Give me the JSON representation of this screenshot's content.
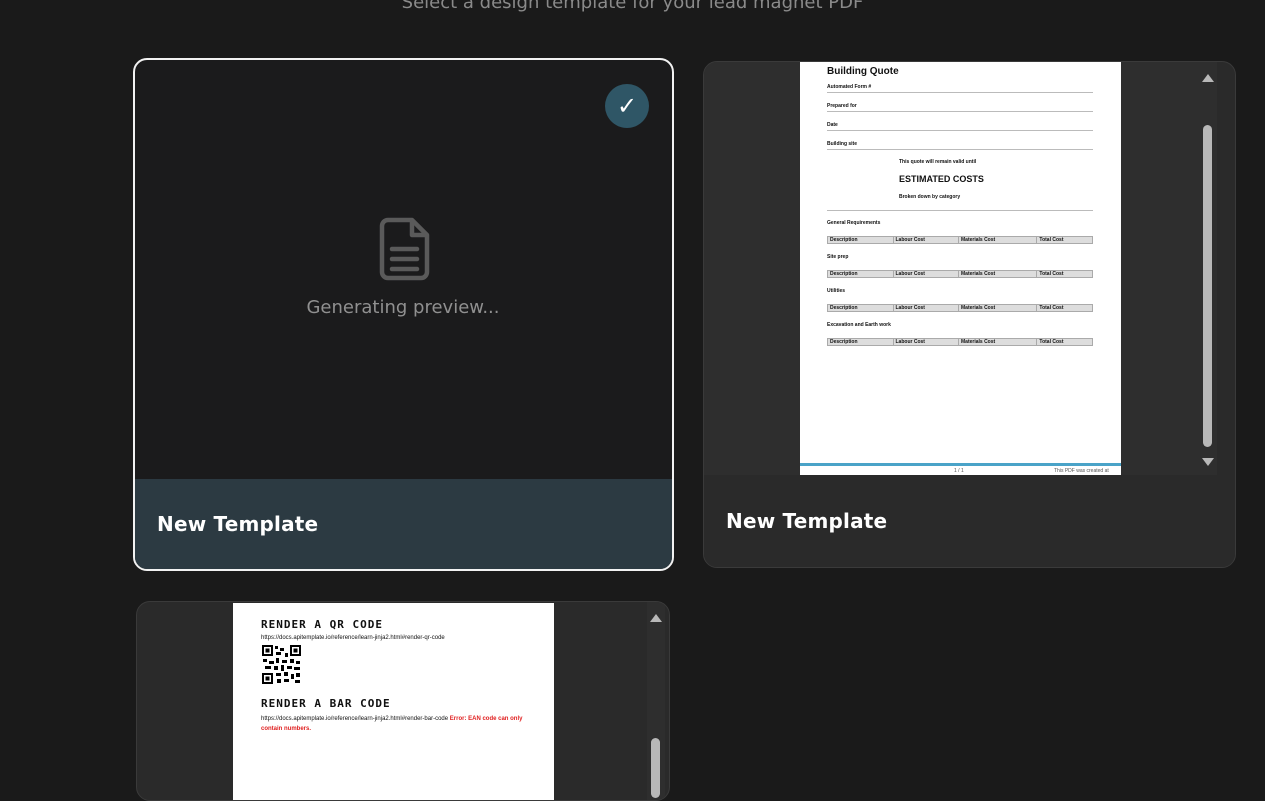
{
  "header": {
    "subtitle": "Select a design template for your lead magnet PDF"
  },
  "templates": [
    {
      "title": "New Template",
      "selected": true,
      "status": "Generating preview...",
      "icon": "document-icon",
      "check_icon": "checkmark-icon",
      "check_glyph": "✓"
    },
    {
      "title": "New Template",
      "selected": false,
      "preview": {
        "doc_title": "Building Quote",
        "fields": [
          "Automated Form #",
          "Prepared for",
          "Date",
          "Building site"
        ],
        "valid_note": "This quote will remain valid until",
        "heading": "ESTIMATED COSTS",
        "subheading": "Broken down by category",
        "sections": [
          "General Requirements",
          "Site prep",
          "Utilities",
          "Excavation and Earth work"
        ],
        "columns": [
          "Description",
          "Labour Cost",
          "Materials Cost",
          "Total Cost"
        ],
        "page_number": "1 / 1",
        "footer_note": "This PDF was created at"
      }
    },
    {
      "title": "",
      "selected": false,
      "preview": {
        "qr_heading": "RENDER A QR CODE",
        "qr_url": "https://docs.apitemplate.io/reference/learn-jinja2.html#render-qr-code",
        "bar_heading": "RENDER A BAR CODE",
        "bar_url": "https://docs.apitemplate.io/reference/learn-jinja2.html#render-bar-code",
        "bar_error": "Error: EAN code can only contain numbers."
      }
    }
  ],
  "colors": {
    "background": "#1a1a1a",
    "selected_footer": "#2c3a42",
    "check_badge": "#2f5666",
    "card": "#2a2a2a"
  }
}
